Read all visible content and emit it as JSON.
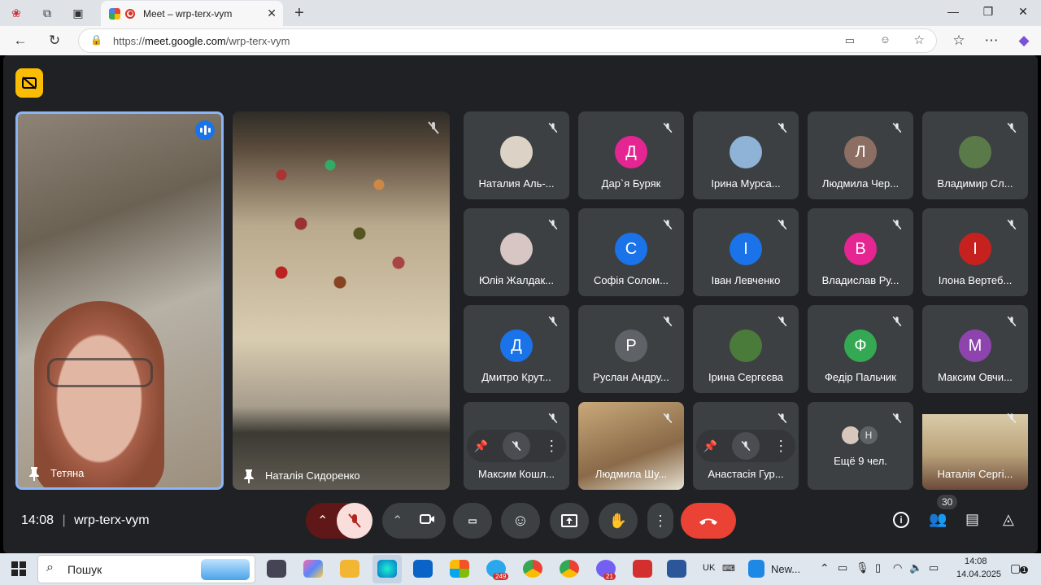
{
  "browser": {
    "tab_title": "Meet – wrp-terx-vym",
    "url_prefix": "https://",
    "url_host": "meet.google.com",
    "url_path": "/wrp-terx-vym"
  },
  "meet": {
    "time": "14:08",
    "separator": "|",
    "meeting_code": "wrp-terx-vym",
    "people_count": "30",
    "featured": [
      {
        "name": "Тетяна"
      },
      {
        "name": "Наталія Сидоренко"
      }
    ],
    "participants": [
      {
        "name": "Наталия Аль-...",
        "initial": "",
        "color": "#dcd3c6"
      },
      {
        "name": "Дар`я Буряк",
        "initial": "Д",
        "color": "#e52592"
      },
      {
        "name": "Ірина Мурса...",
        "initial": "",
        "color": "#8fb3d6"
      },
      {
        "name": "Людмила Чер...",
        "initial": "Л",
        "color": "#8d6e63"
      },
      {
        "name": "Владимир Сл...",
        "initial": "",
        "color": "#5b7a4a"
      },
      {
        "name": "Юлія Жалдак...",
        "initial": "",
        "color": "#d7c6c4"
      },
      {
        "name": "Софія Солом...",
        "initial": "С",
        "color": "#1a73e8"
      },
      {
        "name": "Іван Левченко",
        "initial": "І",
        "color": "#1a73e8"
      },
      {
        "name": "Владислав Ру...",
        "initial": "В",
        "color": "#e52592"
      },
      {
        "name": "Ілона Вертеб...",
        "initial": "І",
        "color": "#c5221f"
      },
      {
        "name": "Дмитро Крут...",
        "initial": "Д",
        "color": "#1a73e8"
      },
      {
        "name": "Руслан Андру...",
        "initial": "Р",
        "color": "#5f6368"
      },
      {
        "name": "Ірина Сергєєва",
        "initial": "",
        "color": "#4a7b3a"
      },
      {
        "name": "Федір Пальчик",
        "initial": "Ф",
        "color": "#34a853"
      },
      {
        "name": "Максим Овчи...",
        "initial": "М",
        "color": "#8e44ad"
      },
      {
        "name": "Максим Кошл...",
        "initial": "",
        "color": ""
      },
      {
        "name": "Людмила Шу...",
        "initial": "",
        "color": ""
      },
      {
        "name": "Анастасія Гур...",
        "initial": "",
        "color": ""
      },
      {
        "name": "Ещё 9 чел.",
        "initial": "Н",
        "color": ""
      },
      {
        "name": "Наталія Сергі...",
        "initial": "",
        "color": ""
      }
    ]
  },
  "taskbar": {
    "search_placeholder": "Пошук",
    "lang": "UK",
    "news": "New...",
    "clock_time": "14:08",
    "clock_date": "14.04.2025",
    "badge_telegram": "249",
    "badge_viber": "21",
    "notif_count": "1"
  }
}
